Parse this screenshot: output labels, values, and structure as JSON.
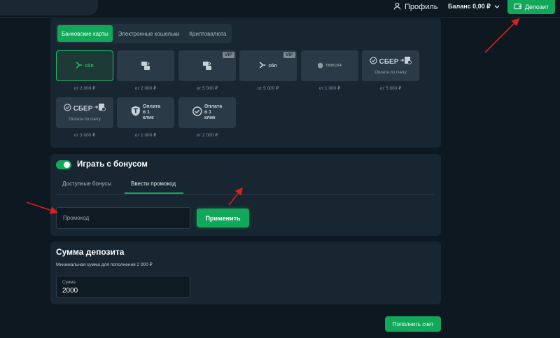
{
  "header": {
    "profile_label": "Профиль",
    "balance_label": "Баланс 0,00 ₽",
    "deposit_button": "Депозит"
  },
  "methods": {
    "tabs": [
      "Банковские карты",
      "Электронные кошельки",
      "Криптовалюта"
    ],
    "active_tab": "Банковские карты",
    "cards": [
      {
        "name": "sbp",
        "logo": "сбп",
        "min": "от 2 000 ₽",
        "selected": true
      },
      {
        "name": "card-transfer",
        "min": "от 2 000 ₽"
      },
      {
        "name": "card-transfer-vip",
        "badge": "VIP",
        "min": "от 5 000 ₽"
      },
      {
        "name": "sbp-vip",
        "badge": "VIP",
        "logo": "сбп",
        "min": "от 5 000 ₽"
      },
      {
        "name": "tinkoff",
        "logo": "TINKOFF",
        "min": "от 1 000 ₽"
      },
      {
        "name": "sber-invoice",
        "logo": "СБЕР",
        "sub": "Оплата по счету",
        "min": "от 5 000 ₽"
      },
      {
        "name": "sber-invoice-2",
        "logo": "СБЕР",
        "sub": "Оплата по счету",
        "min": "от 3 000 ₽"
      },
      {
        "name": "tbank-one-click",
        "line1": "Оплата",
        "line2": "в 1 клик",
        "min": "от 1 000 ₽"
      },
      {
        "name": "sber-one-click",
        "line1": "Оплата",
        "line2": "в 1 клик",
        "min": "от 2 000 ₽"
      }
    ]
  },
  "bonus": {
    "title": "Играть с бонусом",
    "enabled": true,
    "tabs": [
      "Доступные бонусы",
      "Ввести промокод"
    ],
    "active_tab": "Ввести промокод",
    "promo_placeholder": "Промокод",
    "apply_button": "Применить"
  },
  "deposit": {
    "title": "Сумма депозита",
    "min_text": "Минимальная сумма для пополнения 2 000 ₽",
    "field_label": "Сумма",
    "value": "2000",
    "submit_button": "Пополнить счет"
  },
  "colors": {
    "accent": "#12a85a",
    "background": "#0d1820",
    "panel": "#172631",
    "annotation_arrow": "#d91e1e"
  }
}
